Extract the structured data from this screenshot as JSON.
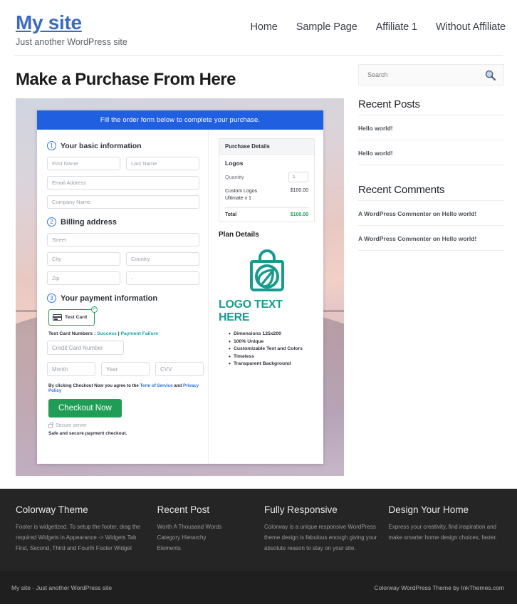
{
  "header": {
    "site_title": "My site",
    "tagline": "Just another WordPress site",
    "nav": [
      {
        "label": "Home"
      },
      {
        "label": "Sample Page"
      },
      {
        "label": "Affiliate 1"
      },
      {
        "label": "Without Affiliate"
      }
    ]
  },
  "main": {
    "page_title": "Make a Purchase From Here",
    "checkout": {
      "banner": "Fill the order form below to complete your purchase.",
      "step1": {
        "number": "1",
        "label": "Your basic information"
      },
      "step2": {
        "number": "2",
        "label": "Billing address"
      },
      "step3": {
        "number": "3",
        "label": "Your payment information"
      },
      "fields": {
        "first_name": "First Name",
        "last_name": "Last Name",
        "email": "Email Address",
        "company": "Company Name",
        "street": "Street",
        "city": "City",
        "country": "Country",
        "zip": "Zip",
        "state": "-",
        "credit_card": "Credit Card Number",
        "month": "Month",
        "year": "Year",
        "cvv": "CVV"
      },
      "card_tab_label": "Test  Card",
      "card_tab_check": "✓",
      "test_cards_prefix": "Test Card Numbers : ",
      "test_cards_success": "Success",
      "test_cards_divider": " | ",
      "test_cards_failure": "Payment Failure",
      "terms_prefix": "By clicking Checkout Now you agree to the ",
      "terms_tos": "Term of Service",
      "terms_and": " and ",
      "terms_privacy": "Privacy Policy",
      "checkout_button": "Checkout Now",
      "secure_server": "Secure server",
      "safe_note": "Safe and secure payment checkout."
    },
    "summary": {
      "heading": "Purchase Details",
      "product": "Logos",
      "quantity_label": "Quantity",
      "quantity_value": "1",
      "line_item_label": "Custom Logos Ultimate x 1",
      "line_item_amount": "$100.00",
      "total_label": "Total",
      "total_amount": "$100.00",
      "plan_title": "Plan Details",
      "logo_text": "LOGO TEXT HERE",
      "features": [
        "Dimensions 125x200",
        "100% Unique",
        "Customizable Text and Colors",
        "Timeless",
        "Transparent Background"
      ]
    }
  },
  "sidebar": {
    "search_placeholder": "Search",
    "recent_posts_title": "Recent Posts",
    "recent_posts": [
      {
        "label": "Hello world!"
      },
      {
        "label": "Hello world!"
      }
    ],
    "recent_comments_title": "Recent Comments",
    "recent_comments": [
      {
        "label": "A WordPress Commenter on Hello world!"
      },
      {
        "label": "A WordPress Commenter on Hello world!"
      }
    ]
  },
  "footer": {
    "columns": [
      {
        "title": "Colorway Theme",
        "text": "Footer is widgetized. To setup the footer, drag the required Widgets in Appearance -> Widgets Tab First, Second, Third and Fourth Footer Widget"
      },
      {
        "title": "Recent Post",
        "items": [
          {
            "label": "Worth A Thousand Words"
          },
          {
            "label": "Category Hierarchy"
          },
          {
            "label": "Elements"
          }
        ]
      },
      {
        "title": "Fully Responsive",
        "text": "Colorway is a unique responsive WordPress theme design is fabulous enough giving your absolute reason to stay on your site."
      },
      {
        "title": "Design Your Home",
        "text": "Express your creativity, find inspiration and make smarter home design choices, faster."
      }
    ],
    "bar_left": "My site - Just another WordPress site",
    "bar_right": "Colorway WordPress Theme by InkThemes.com"
  },
  "colors": {
    "brand_blue": "#3c6bbd",
    "banner_blue": "#1f5fe0",
    "green": "#1f9d55",
    "teal": "#179b8e",
    "total_green": "#18a558"
  }
}
